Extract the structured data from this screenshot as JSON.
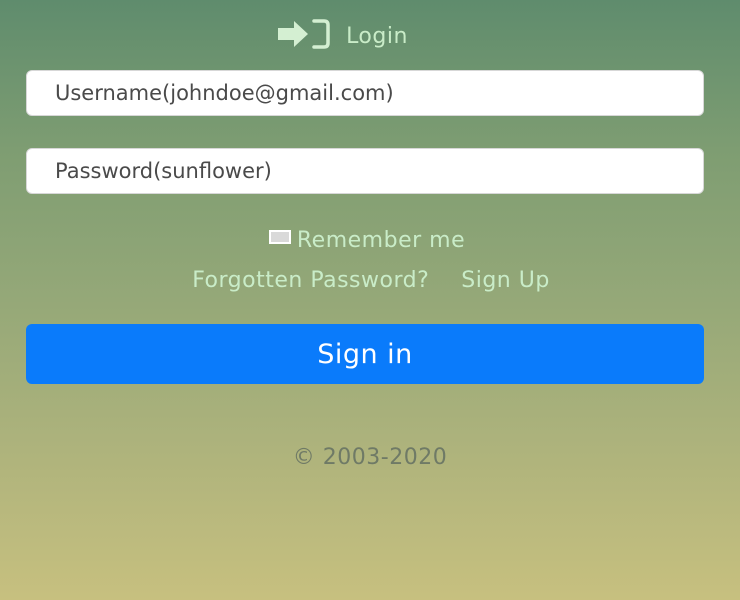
{
  "header": {
    "icon": "sign-in-icon",
    "title": "Login"
  },
  "form": {
    "username_placeholder": "Username(johndoe@gmail.com)",
    "username_value": "",
    "password_placeholder": "Password(sunflower)",
    "password_value": "",
    "remember_label": "Remember me",
    "remember_checked": false,
    "forgot_link": "Forgotten Password?",
    "signup_link": "Sign Up",
    "submit_label": "Sign in"
  },
  "footer": {
    "copyright": "© 2003-2020"
  },
  "colors": {
    "accent": "#0a7bfb",
    "link_text": "#c9ecc8",
    "background_top": "#5f8c6d",
    "background_bottom": "#c7c07f"
  }
}
